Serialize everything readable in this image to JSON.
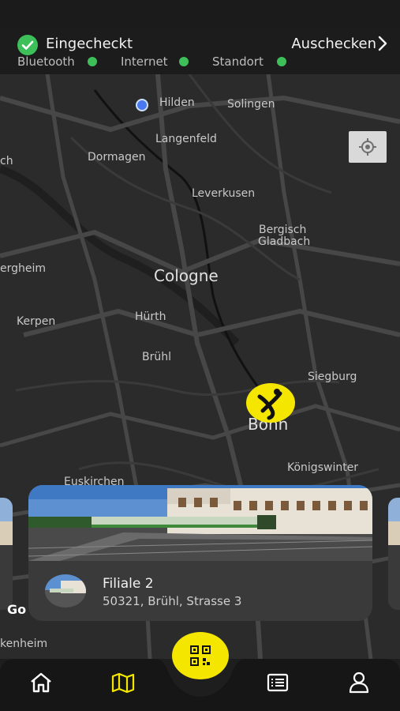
{
  "status": {
    "checked_in_label": "Eingecheckt",
    "checkout_label": "Auschecken",
    "indicators": [
      {
        "label": "Bluetooth",
        "state": "on",
        "color": "#3dbf5a"
      },
      {
        "label": "Internet",
        "state": "on",
        "color": "#3dbf5a"
      },
      {
        "label": "Standort",
        "state": "on",
        "color": "#3dbf5a"
      }
    ]
  },
  "map": {
    "cities": [
      "Hilden",
      "Solingen",
      "Langenfeld",
      "Dormagen",
      "Leverkusen",
      "Bergisch",
      "Gladbach",
      "Cologne",
      "ergheim",
      "Hürth",
      "Kerpen",
      "Brühl",
      "Siegburg",
      "Bonn",
      "Königswinter",
      "Euskirchen",
      "kenheim",
      "ch"
    ],
    "attribution": "Go",
    "marker_icon": "x-brand-marker-icon",
    "locate_icon": "crosshair-icon"
  },
  "branch": {
    "name": "Filiale 2",
    "address": "50321, Brühl, Strasse 3"
  },
  "nav": {
    "items": [
      {
        "icon": "home-icon",
        "active": false
      },
      {
        "icon": "map-icon",
        "active": true
      },
      {
        "icon": "qr-code-icon",
        "active": false
      },
      {
        "icon": "list-icon",
        "active": false
      },
      {
        "icon": "user-icon",
        "active": false
      }
    ]
  },
  "colors": {
    "accent": "#f5e600",
    "success": "#3dbf5a",
    "map_background": "#2a2a2a",
    "card": "#3a3a3a"
  }
}
